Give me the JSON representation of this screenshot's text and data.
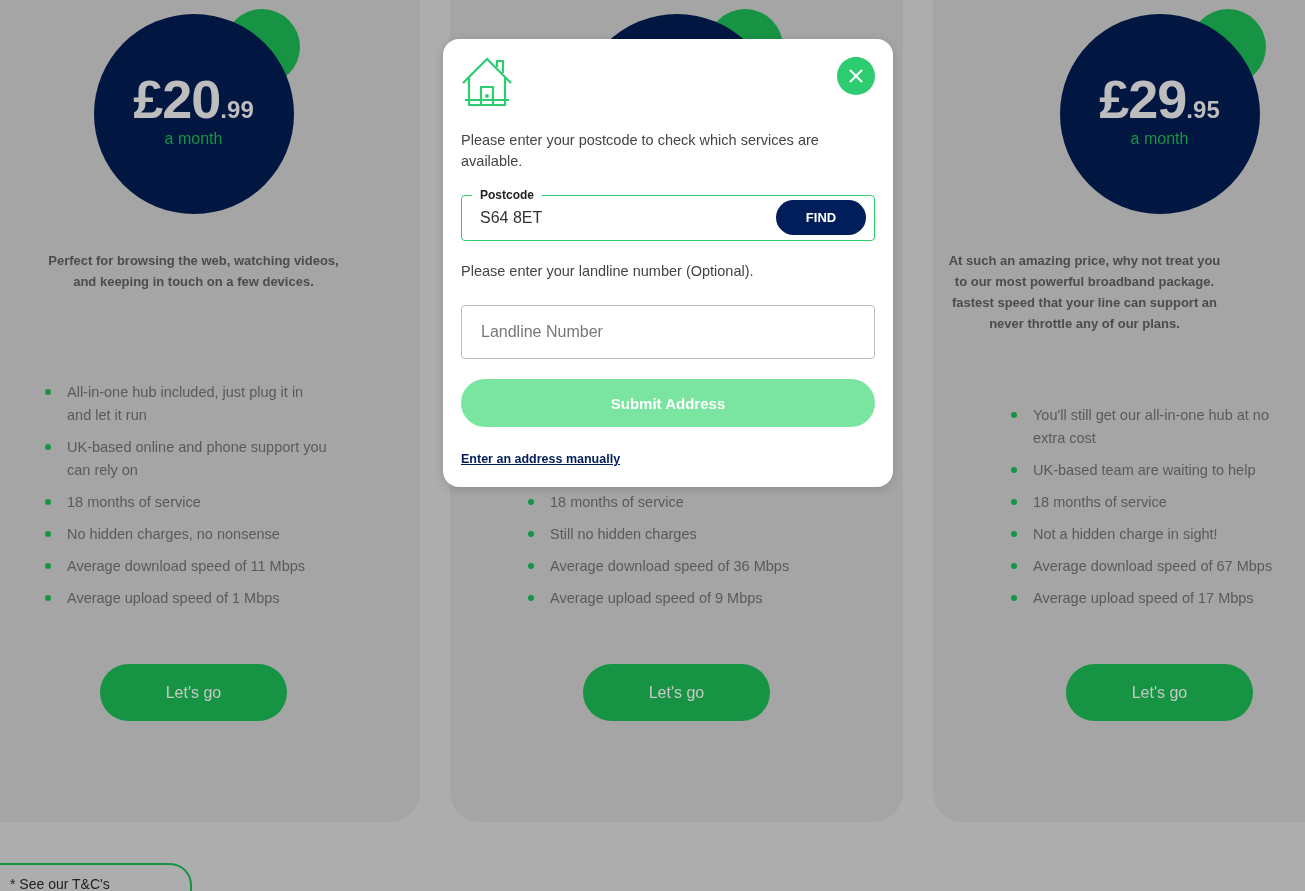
{
  "plans": [
    {
      "price_main": "£20",
      "price_pence": ".99",
      "period": "a month",
      "description": [
        "Perfect for browsing the web, watching videos,",
        "and keeping in touch on a few devices."
      ],
      "features": [
        "All-in-one hub included, just plug it in and let it run",
        "UK-based online and phone support you can rely on",
        "18 months of service",
        "No hidden charges, no nonsense",
        "Average download speed of 11 Mbps",
        "Average upload speed of 1 Mbps"
      ],
      "button": "Let's go"
    },
    {
      "features": [
        "18 months of service",
        "Still no hidden charges",
        "Average download speed of 36 Mbps",
        "Average upload speed of 9 Mbps"
      ],
      "button": "Let's go"
    },
    {
      "price_main": "£29",
      "price_pence": ".95",
      "period": "a month",
      "description": [
        "At such an amazing price, why not treat you",
        "to our most powerful broadband package.",
        "fastest speed that your line can support an",
        "never throttle any of our plans."
      ],
      "features": [
        "You'll still get our all-in-one hub at no extra cost",
        "UK-based team are waiting to help",
        "18 months of service",
        "Not a hidden charge in sight!",
        "Average download speed of 67 Mbps",
        "Average upload speed of 17 Mbps"
      ],
      "button": "Let's go"
    }
  ],
  "modal": {
    "intro": "Please enter your postcode to check which services are available.",
    "postcode": {
      "label": "Postcode",
      "value": "S64 8ET",
      "button": "FIND"
    },
    "landline_prompt": "Please enter your landline number (Optional).",
    "landline": {
      "placeholder": "Landline Number"
    },
    "submit": {
      "label": "Submit Address",
      "disabled": true
    },
    "manual_link": "Enter an address manually"
  },
  "footer_tab": "* See our T&C's"
}
